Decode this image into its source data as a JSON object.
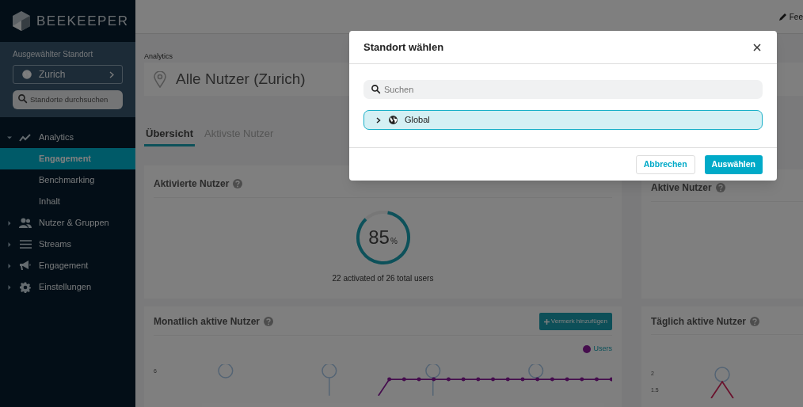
{
  "brand": {
    "name": "BEEKEEPER"
  },
  "sidebar": {
    "location_label": "Ausgewählter Standort",
    "location": "Zurich",
    "search_placeholder": "Standorte durchsuchen",
    "nav": [
      {
        "label": "Analytics",
        "expanded": true,
        "children": [
          {
            "label": "Engagement",
            "selected": true
          },
          {
            "label": "Benchmarking",
            "selected": false
          },
          {
            "label": "Inhalt",
            "selected": false
          }
        ]
      },
      {
        "label": "Nutzer & Gruppen",
        "expanded": false
      },
      {
        "label": "Streams",
        "expanded": false
      },
      {
        "label": "Engagement",
        "expanded": false
      },
      {
        "label": "Einstellungen",
        "expanded": false
      }
    ]
  },
  "topbar": {
    "link": "Fee"
  },
  "breadcrumb": "Analytics",
  "header": {
    "title": "Alle Nutzer (Zurich)"
  },
  "tabs": [
    {
      "label": "Übersicht",
      "selected": true
    },
    {
      "label": "Aktivste Nutzer",
      "selected": false
    }
  ],
  "activated_card": {
    "title": "Aktivierte Nutzer",
    "value": "85",
    "unit": "%",
    "level": 0.85,
    "caption": "22 activated of 26 total users"
  },
  "active_card": {
    "title": "Aktive Nutzer"
  },
  "monthly_card": {
    "title": "Monatlich aktive Nutzer",
    "button": "Vermerk hinzufügen",
    "legend": "Users",
    "y_ticks": [
      "6"
    ]
  },
  "daily_card": {
    "title": "Täglich aktive Nutzer",
    "y_ticks": [
      "2",
      "1.5"
    ]
  },
  "modal": {
    "title": "Standort wählen",
    "search_placeholder": "Suchen",
    "tree": [
      {
        "label": "Global",
        "selected": true,
        "expanded": false
      }
    ],
    "buttons": [
      {
        "label": "Abbrechen",
        "kind": "secondary"
      },
      {
        "label": "Auswählen",
        "kind": "primary"
      }
    ]
  }
}
